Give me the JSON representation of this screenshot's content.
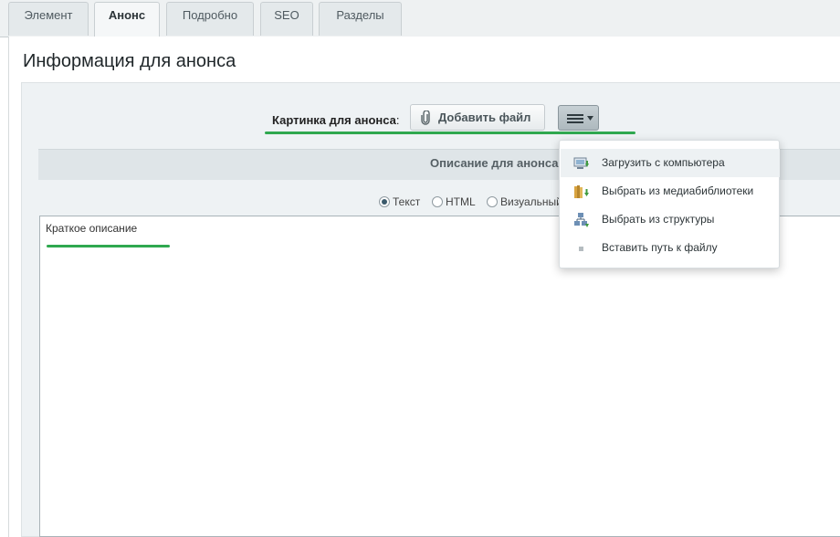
{
  "tabs": [
    {
      "label": "Элемент"
    },
    {
      "label": "Анонс",
      "active": true
    },
    {
      "label": "Подробно"
    },
    {
      "label": "SEO"
    },
    {
      "label": "Разделы"
    }
  ],
  "page_title": "Информация для анонса",
  "picture": {
    "label": "Картинка для анонса",
    "colon": ":",
    "add_file_label": "Добавить файл",
    "menu_button_icon": "hamburger-icon"
  },
  "description": {
    "header": "Описание для анонса",
    "radio_options": [
      {
        "label": "Текст",
        "checked": true
      },
      {
        "label": "HTML",
        "checked": false
      },
      {
        "label": "Визуальный",
        "checked": false
      }
    ],
    "textarea_value": "Краткое описание"
  },
  "dropdown": {
    "items": [
      {
        "label": "Загрузить с компьютера",
        "icon": "upload-computer-icon"
      },
      {
        "label": "Выбрать из медиабиблиотеки",
        "icon": "media-library-icon"
      },
      {
        "label": "Выбрать из структуры",
        "icon": "structure-icon"
      },
      {
        "label": "Вставить путь к файлу",
        "icon": "bullet-icon"
      }
    ]
  },
  "colors": {
    "highlight": "#2fa84f",
    "tab_bg": "#e4e9eb",
    "content_bg": "#eef2f4"
  }
}
